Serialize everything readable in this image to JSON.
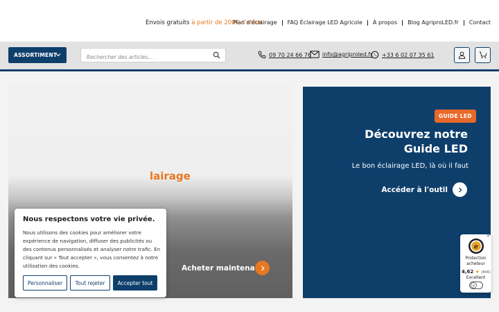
{
  "topbar": {
    "promo_prefix": "Envois gratuits",
    "promo_highlight": "à partir de 200€ d'achat",
    "links": [
      "Plan d'éclairage",
      "FAQ Éclairage LED Agricole",
      "À propos",
      "Blog AgriproLED.fr",
      "Contact"
    ]
  },
  "nav": {
    "assortment_label": "ASSORTIMENT",
    "search_placeholder": "Rechercher des articles...",
    "phone1": "09 70 24 66 76",
    "email": "info@agriproled.fr",
    "whatsapp": "+33 6 02 07 35 61"
  },
  "hero_left": {
    "partial_text": "lairage",
    "cta_label": "Acheter maintenant"
  },
  "hero_right": {
    "badge": "GUIDE LED",
    "title": "Découvrez notre Guide LED",
    "subtitle": "Le bon éclairage LED, là où il faut",
    "cta_label": "Accéder à l'outil"
  },
  "cookie": {
    "title": "Nous respectons votre vie privée.",
    "text": "Nous utilisons des cookies pour améliorer votre expérience de navigation, diffuser des publicités ou des contenus personnalisés et analyser notre trafic. En cliquant sur « Tout accepter », vous consentez à notre utilisation des cookies.",
    "btn_customize": "Personnaliser",
    "btn_reject": "Tout rejeter",
    "btn_accept": "Accepter tout"
  },
  "trust": {
    "label": "Protection acheteur",
    "score": "4,62",
    "count": "(846)",
    "verdict": "Excellent",
    "close": "✕"
  },
  "colors": {
    "primary": "#0e3f6b",
    "accent": "#e87722",
    "badge": "#e8682a"
  },
  "icons": [
    "chevron-down-icon",
    "search-icon",
    "phone-icon",
    "mail-icon",
    "whatsapp-icon",
    "user-icon",
    "cart-icon",
    "arrow-right-icon",
    "trusted-seal-icon",
    "star-icon"
  ]
}
